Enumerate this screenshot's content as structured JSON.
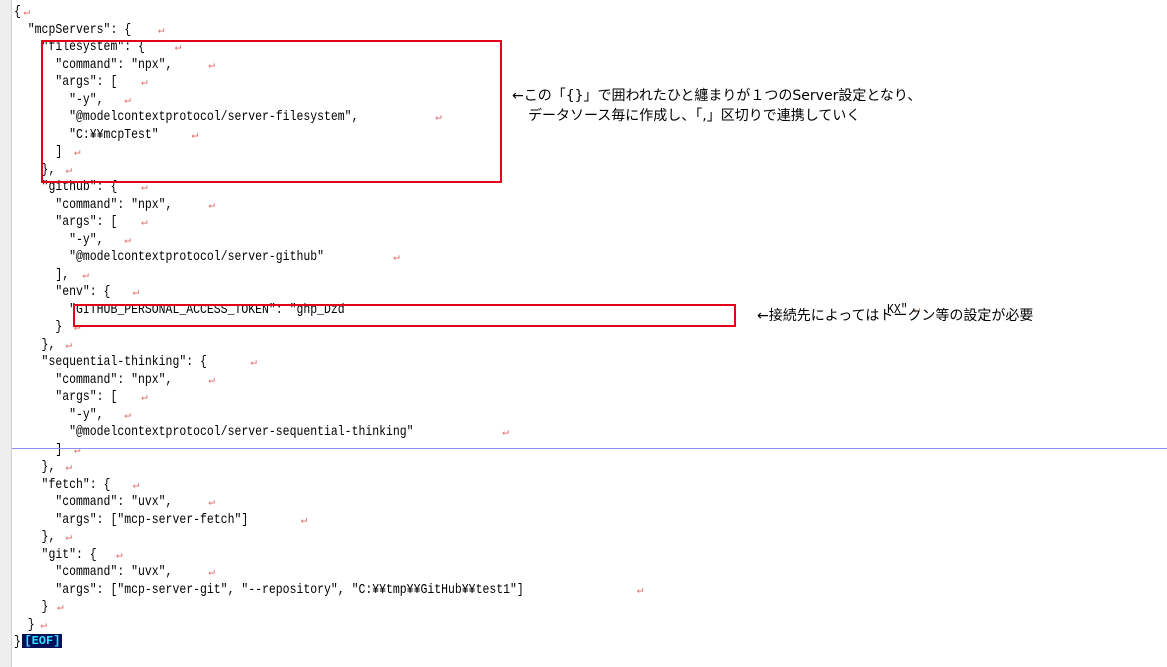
{
  "code_lines": [
    "{",
    "  \"mcpServers\": {",
    "    \"filesystem\": {",
    "      \"command\": \"npx\",",
    "      \"args\": [",
    "        \"-y\",",
    "        \"@modelcontextprotocol/server-filesystem\",",
    "        \"C:¥¥mcpTest\"",
    "      ]",
    "    },",
    "    \"github\": {",
    "      \"command\": \"npx\",",
    "      \"args\": [",
    "        \"-y\",",
    "        \"@modelcontextprotocol/server-github\"",
    "      ],",
    "      \"env\": {",
    "        \"GITHUB_PERSONAL_ACCESS_TOKEN\": \"ghp_Dzd",
    "      }",
    "    },",
    "    \"sequential-thinking\": {",
    "      \"command\": \"npx\",",
    "      \"args\": [",
    "        \"-y\",",
    "        \"@modelcontextprotocol/server-sequential-thinking\"",
    "      ]",
    "    },",
    "    \"fetch\": {",
    "      \"command\": \"uvx\",",
    "      \"args\": [\"mcp-server-fetch\"]",
    "    },",
    "    \"git\": {",
    "      \"command\": \"uvx\",",
    "      \"args\": [\"mcp-server-git\", \"--repository\", \"C:¥¥tmp¥¥GitHub¥¥test1\"]",
    "    }",
    "  }",
    "}"
  ],
  "token_suffix": "KX\"",
  "newline_mark": "↵",
  "eof_label": "[EOF]",
  "annotations": {
    "filesystem_line1": "←この「{}」で囲われたひと纏まりが１つのServer設定となり、",
    "filesystem_line2": "データソース毎に作成し、「,」区切りで連携していく",
    "token": "←接続先によってはトークン等の設定が必要"
  },
  "colors": {
    "highlight_box": "#e3001b",
    "newline_mark": "#e06a6a",
    "eof_bg": "#000f5a",
    "eof_fg": "#33e0ff",
    "cursor_line": "#8f8ff0",
    "gutter": "#eeeeee"
  }
}
